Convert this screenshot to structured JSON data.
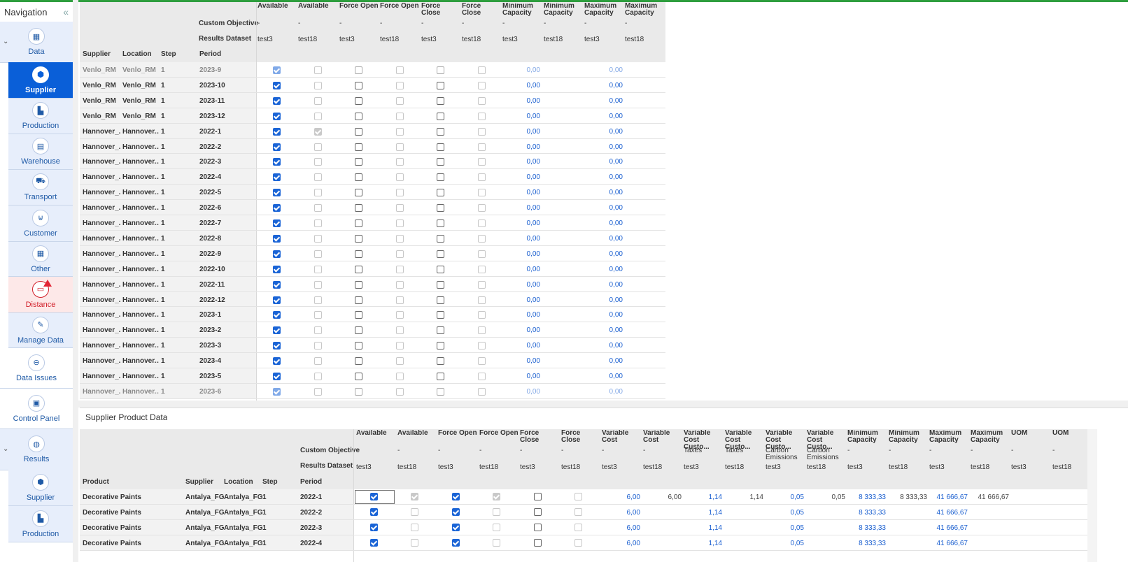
{
  "nav": {
    "title": "Navigation",
    "collapse_icon": "«",
    "groups": [
      {
        "label": "Data",
        "icon": "grid-icon"
      },
      {
        "label": "Results",
        "icon": "globe-icon"
      }
    ],
    "items": [
      {
        "label": "Supplier",
        "icon": "supplier-icon",
        "state": "active"
      },
      {
        "label": "Production",
        "icon": "factory-icon"
      },
      {
        "label": "Warehouse",
        "icon": "warehouse-icon"
      },
      {
        "label": "Transport",
        "icon": "truck-icon"
      },
      {
        "label": "Customer",
        "icon": "basket-icon"
      },
      {
        "label": "Other",
        "icon": "grid-icon"
      },
      {
        "label": "Distance",
        "icon": "ruler-icon",
        "state": "warning"
      },
      {
        "label": "Manage Data",
        "icon": "edit-icon"
      },
      {
        "label": "Data Issues",
        "icon": "minus-circle-icon"
      },
      {
        "label": "Control Panel",
        "icon": "panel-icon"
      },
      {
        "label": "Supplier",
        "icon": "supplier-icon"
      },
      {
        "label": "Production",
        "icon": "factory-icon"
      }
    ]
  },
  "top_grid": {
    "row_headers": [
      "Custom Objective",
      "Results Dataset"
    ],
    "key_columns": [
      "Supplier",
      "Location",
      "Step",
      "Period"
    ],
    "columns": [
      {
        "title": "Available",
        "objective": "-",
        "dataset": "test3"
      },
      {
        "title": "Available",
        "objective": "-",
        "dataset": "test18"
      },
      {
        "title": "Force Open",
        "objective": "-",
        "dataset": "test3"
      },
      {
        "title": "Force Open",
        "objective": "-",
        "dataset": "test18"
      },
      {
        "title": "Force Close",
        "objective": "-",
        "dataset": "test3"
      },
      {
        "title": "Force Close",
        "objective": "-",
        "dataset": "test18"
      },
      {
        "title": "Minimum Capacity",
        "objective": "-",
        "dataset": "test3"
      },
      {
        "title": "Minimum Capacity",
        "objective": "-",
        "dataset": "test18"
      },
      {
        "title": "Maximum Capacity",
        "objective": "-",
        "dataset": "test3"
      },
      {
        "title": "Maximum Capacity",
        "objective": "-",
        "dataset": "test18"
      }
    ],
    "rows": [
      {
        "supplier": "Venlo_RM",
        "location": "Venlo_RM",
        "step": "1",
        "period": "2023-9",
        "avail18": false,
        "min": "0,00",
        "max": "0,00"
      },
      {
        "supplier": "Venlo_RM",
        "location": "Venlo_RM",
        "step": "1",
        "period": "2023-10",
        "avail18": false,
        "min": "0,00",
        "max": "0,00"
      },
      {
        "supplier": "Venlo_RM",
        "location": "Venlo_RM",
        "step": "1",
        "period": "2023-11",
        "avail18": false,
        "min": "0,00",
        "max": "0,00"
      },
      {
        "supplier": "Venlo_RM",
        "location": "Venlo_RM",
        "step": "1",
        "period": "2023-12",
        "avail18": false,
        "min": "0,00",
        "max": "0,00"
      },
      {
        "supplier": "Hannover_...",
        "location": "Hannover...",
        "step": "1",
        "period": "2022-1",
        "avail18": true,
        "min": "0,00",
        "max": "0,00"
      },
      {
        "supplier": "Hannover_...",
        "location": "Hannover...",
        "step": "1",
        "period": "2022-2",
        "avail18": false,
        "min": "0,00",
        "max": "0,00"
      },
      {
        "supplier": "Hannover_...",
        "location": "Hannover...",
        "step": "1",
        "period": "2022-3",
        "avail18": false,
        "min": "0,00",
        "max": "0,00"
      },
      {
        "supplier": "Hannover_...",
        "location": "Hannover...",
        "step": "1",
        "period": "2022-4",
        "avail18": false,
        "min": "0,00",
        "max": "0,00"
      },
      {
        "supplier": "Hannover_...",
        "location": "Hannover...",
        "step": "1",
        "period": "2022-5",
        "avail18": false,
        "min": "0,00",
        "max": "0,00"
      },
      {
        "supplier": "Hannover_...",
        "location": "Hannover...",
        "step": "1",
        "period": "2022-6",
        "avail18": false,
        "min": "0,00",
        "max": "0,00"
      },
      {
        "supplier": "Hannover_...",
        "location": "Hannover...",
        "step": "1",
        "period": "2022-7",
        "avail18": false,
        "min": "0,00",
        "max": "0,00"
      },
      {
        "supplier": "Hannover_...",
        "location": "Hannover...",
        "step": "1",
        "period": "2022-8",
        "avail18": false,
        "min": "0,00",
        "max": "0,00"
      },
      {
        "supplier": "Hannover_...",
        "location": "Hannover...",
        "step": "1",
        "period": "2022-9",
        "avail18": false,
        "min": "0,00",
        "max": "0,00"
      },
      {
        "supplier": "Hannover_...",
        "location": "Hannover...",
        "step": "1",
        "period": "2022-10",
        "avail18": false,
        "min": "0,00",
        "max": "0,00"
      },
      {
        "supplier": "Hannover_...",
        "location": "Hannover...",
        "step": "1",
        "period": "2022-11",
        "avail18": false,
        "min": "0,00",
        "max": "0,00"
      },
      {
        "supplier": "Hannover_...",
        "location": "Hannover...",
        "step": "1",
        "period": "2022-12",
        "avail18": false,
        "min": "0,00",
        "max": "0,00"
      },
      {
        "supplier": "Hannover_...",
        "location": "Hannover...",
        "step": "1",
        "period": "2023-1",
        "avail18": false,
        "min": "0,00",
        "max": "0,00"
      },
      {
        "supplier": "Hannover_...",
        "location": "Hannover...",
        "step": "1",
        "period": "2023-2",
        "avail18": false,
        "min": "0,00",
        "max": "0,00"
      },
      {
        "supplier": "Hannover_...",
        "location": "Hannover...",
        "step": "1",
        "period": "2023-3",
        "avail18": false,
        "min": "0,00",
        "max": "0,00"
      },
      {
        "supplier": "Hannover_...",
        "location": "Hannover...",
        "step": "1",
        "period": "2023-4",
        "avail18": false,
        "min": "0,00",
        "max": "0,00"
      },
      {
        "supplier": "Hannover_...",
        "location": "Hannover...",
        "step": "1",
        "period": "2023-5",
        "avail18": false,
        "min": "0,00",
        "max": "0,00"
      },
      {
        "supplier": "Hannover_...",
        "location": "Hannover...",
        "step": "1",
        "period": "2023-6",
        "avail18": false,
        "min": "0,00",
        "max": "0,00"
      }
    ]
  },
  "bottom_grid": {
    "title": "Supplier Product Data",
    "row_headers": [
      "Custom Objective",
      "Results Dataset"
    ],
    "key_columns": [
      "Product",
      "Supplier",
      "Location",
      "Step",
      "Period"
    ],
    "columns": [
      {
        "title": "Available",
        "objective": "-",
        "dataset": "test3"
      },
      {
        "title": "Available",
        "objective": "-",
        "dataset": "test18"
      },
      {
        "title": "Force Open",
        "objective": "-",
        "dataset": "test3"
      },
      {
        "title": "Force Open",
        "objective": "-",
        "dataset": "test18"
      },
      {
        "title": "Force Close",
        "objective": "-",
        "dataset": "test3"
      },
      {
        "title": "Force Close",
        "objective": "-",
        "dataset": "test18"
      },
      {
        "title": "Variable Cost",
        "objective": "-",
        "dataset": "test3"
      },
      {
        "title": "Variable Cost",
        "objective": "-",
        "dataset": "test18"
      },
      {
        "title": "Variable Cost Custo...",
        "objective": "Taxes",
        "dataset": "test3"
      },
      {
        "title": "Variable Cost Custo...",
        "objective": "Taxes",
        "dataset": "test18"
      },
      {
        "title": "Variable Cost Custo...",
        "objective": "Carbon Emissions",
        "dataset": "test3"
      },
      {
        "title": "Variable Cost Custo...",
        "objective": "Carbon Emissions",
        "dataset": "test18"
      },
      {
        "title": "Minimum Capacity",
        "objective": "-",
        "dataset": "test3"
      },
      {
        "title": "Minimum Capacity",
        "objective": "-",
        "dataset": "test18"
      },
      {
        "title": "Maximum Capacity",
        "objective": "-",
        "dataset": "test3"
      },
      {
        "title": "Maximum Capacity",
        "objective": "-",
        "dataset": "test18"
      },
      {
        "title": "UOM",
        "objective": "-",
        "dataset": "test3"
      },
      {
        "title": "UOM",
        "objective": "-",
        "dataset": "test18"
      }
    ],
    "rows": [
      {
        "product": "Decorative Paints",
        "supplier": "Antalya_FG",
        "location": "Antalya_FG",
        "step": "1",
        "period": "2022-1",
        "b18": true,
        "vc3": "6,00",
        "vc18": "6,00",
        "tx3": "1,14",
        "tx18": "1,14",
        "ce3": "0,05",
        "ce18": "0,05",
        "mn3": "8 333,33",
        "mn18": "8 333,33",
        "mx3": "41 666,67",
        "mx18": "41 666,67"
      },
      {
        "product": "Decorative Paints",
        "supplier": "Antalya_FG",
        "location": "Antalya_FG",
        "step": "1",
        "period": "2022-2",
        "b18": false,
        "vc3": "6,00",
        "vc18": "",
        "tx3": "1,14",
        "tx18": "",
        "ce3": "0,05",
        "ce18": "",
        "mn3": "8 333,33",
        "mn18": "",
        "mx3": "41 666,67",
        "mx18": ""
      },
      {
        "product": "Decorative Paints",
        "supplier": "Antalya_FG",
        "location": "Antalya_FG",
        "step": "1",
        "period": "2022-3",
        "b18": false,
        "vc3": "6,00",
        "vc18": "",
        "tx3": "1,14",
        "tx18": "",
        "ce3": "0,05",
        "ce18": "",
        "mn3": "8 333,33",
        "mn18": "",
        "mx3": "41 666,67",
        "mx18": ""
      },
      {
        "product": "Decorative Paints",
        "supplier": "Antalya_FG",
        "location": "Antalya_FG",
        "step": "1",
        "period": "2022-4",
        "b18": false,
        "vc3": "6,00",
        "vc18": "",
        "tx3": "1,14",
        "tx18": "",
        "ce3": "0,05",
        "ce18": "",
        "mn3": "8 333,33",
        "mn18": "",
        "mx3": "41 666,67",
        "mx18": ""
      }
    ]
  }
}
